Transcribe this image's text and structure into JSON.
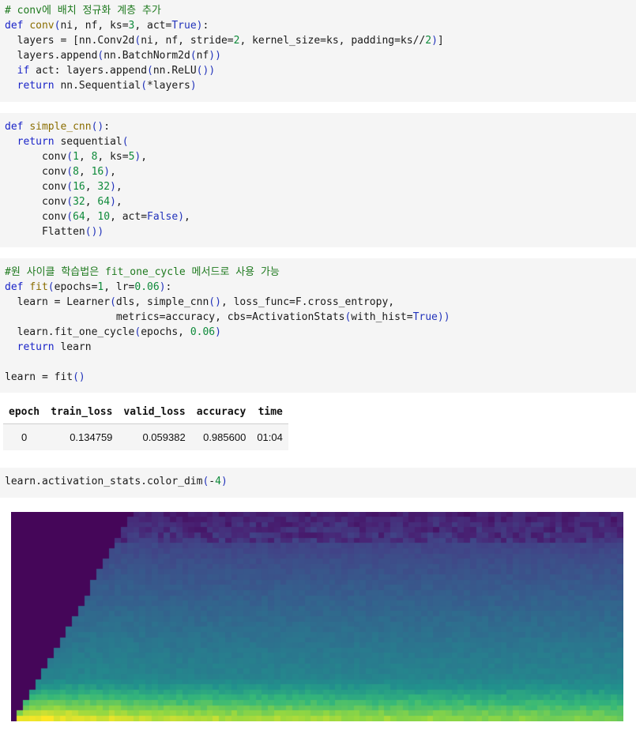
{
  "cells": {
    "cell1": [
      "# conv에 배치 정규화 계층 추가",
      "def conv(ni, nf, ks=3, act=True):",
      "  layers = [nn.Conv2d(ni, nf, stride=2, kernel_size=ks, padding=ks//2)]",
      "  layers.append(nn.BatchNorm2d(nf))",
      "  if act: layers.append(nn.ReLU())",
      "  return nn.Sequential(*layers)"
    ],
    "cell2": [
      "def simple_cnn():",
      "  return sequential(",
      "      conv(1, 8, ks=5),",
      "      conv(8, 16),",
      "      conv(16, 32),",
      "      conv(32, 64),",
      "      conv(64, 10, act=False),",
      "      Flatten())"
    ],
    "cell3": [
      "#원 사이클 학습법은 fit_one_cycle 메서드로 사용 가능",
      "def fit(epochs=1, lr=0.06):",
      "  learn = Learner(dls, simple_cnn(), loss_func=F.cross_entropy,",
      "                  metrics=accuracy, cbs=ActivationStats(with_hist=True))",
      "  learn.fit_one_cycle(epochs, 0.06)",
      "  return learn",
      "",
      "learn = fit()"
    ],
    "cell4": [
      "learn.activation_stats.color_dim(-4)"
    ]
  },
  "results_table": {
    "headers": [
      "epoch",
      "train_loss",
      "valid_loss",
      "accuracy",
      "time"
    ],
    "rows": [
      [
        "0",
        "0.134759",
        "0.059382",
        "0.985600",
        "01:04"
      ]
    ]
  },
  "colors": {
    "cell_background": "#f5f5f5",
    "keyword": "#1a24c8",
    "number": "#0e8a3a",
    "comment": "#1f7a1f",
    "colormap": "viridis"
  }
}
